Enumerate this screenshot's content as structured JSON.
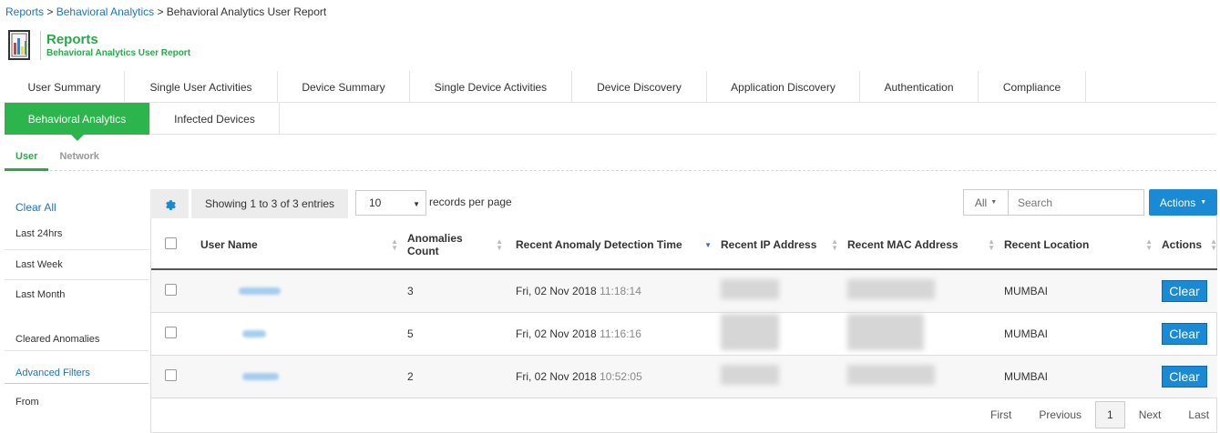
{
  "breadcrumb": {
    "items": [
      "Reports",
      "Behavioral Analytics",
      "Behavioral Analytics User Report"
    ],
    "sep": " > "
  },
  "header": {
    "title": "Reports",
    "subtitle": "Behavioral Analytics User Report",
    "icon": "report-book-icon"
  },
  "tabs_row1": [
    "User Summary",
    "Single User Activities",
    "Device Summary",
    "Single Device Activities",
    "Device Discovery",
    "Application Discovery",
    "Authentication",
    "Compliance"
  ],
  "tabs_row2": [
    "Behavioral Analytics",
    "Infected Devices"
  ],
  "active_tab": "Behavioral Analytics",
  "subtabs": [
    "User",
    "Network"
  ],
  "sidebar": {
    "clear_all": "Clear All",
    "items": [
      "Last 24hrs",
      "Last Week",
      "Last Month",
      "Cleared Anomalies"
    ],
    "advanced": "Advanced Filters",
    "from": "From"
  },
  "toolbar": {
    "showing": "Showing 1 to 3 of 3 entries",
    "per_page_value": "10",
    "per_page_label": "records per page",
    "filter_all": "All",
    "search_placeholder": "Search",
    "actions": "Actions"
  },
  "table": {
    "headers": [
      "User Name",
      "Anomalies Count",
      "Recent Anomaly Detection Time",
      "Recent IP Address",
      "Recent MAC Address",
      "Recent Location",
      "Actions"
    ],
    "rows": [
      {
        "count": "3",
        "date": "Fri, 02 Nov 2018",
        "time": "11:18:14",
        "location": "MUMBAI",
        "action": "Clear"
      },
      {
        "count": "5",
        "date": "Fri, 02 Nov 2018",
        "time": "11:16:16",
        "location": "MUMBAI",
        "action": "Clear"
      },
      {
        "count": "2",
        "date": "Fri, 02 Nov 2018",
        "time": "10:52:05",
        "location": "MUMBAI",
        "action": "Clear"
      }
    ]
  },
  "pagination": {
    "first": "First",
    "previous": "Previous",
    "current": "1",
    "next": "Next",
    "last": "Last"
  },
  "colors": {
    "green": "#2cb54c",
    "blue": "#1a8ad4",
    "link": "#1a73c8"
  }
}
